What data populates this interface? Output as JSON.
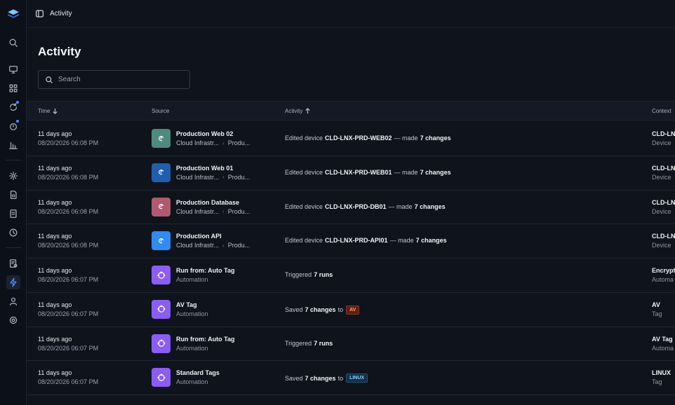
{
  "topbar": {
    "title": "Activity"
  },
  "page": {
    "title": "Activity"
  },
  "search": {
    "placeholder": "Search"
  },
  "columns": {
    "time": "Time",
    "source": "Source",
    "activity": "Activity",
    "context": "Context"
  },
  "colors": {
    "accent": "#4d8dff",
    "automation": "#8b5cf6",
    "web02": "#4f8a7f",
    "web01": "#1f5fae",
    "db": "#b05a6e",
    "api": "#2f8bf5"
  },
  "rows": [
    {
      "time": "11 days ago",
      "date": "08/20/2026 06:08 PM",
      "icon": "debian-icon",
      "color": "#4f8a7f",
      "src_name": "Production Web 02",
      "src_path1": "Cloud Infrastr...",
      "src_path2": "Produ...",
      "type": "edit",
      "verb": "Edited device",
      "target": "CLD-LNX-PRD-WEB02",
      "mid": "— made",
      "count": "7 changes",
      "ctx1": "CLD-LN",
      "ctx2": "Device"
    },
    {
      "time": "11 days ago",
      "date": "08/20/2026 06:08 PM",
      "icon": "debian-icon",
      "color": "#1f5fae",
      "src_name": "Production Web 01",
      "src_path1": "Cloud Infrastr...",
      "src_path2": "Produ...",
      "type": "edit",
      "verb": "Edited device",
      "target": "CLD-LNX-PRD-WEB01",
      "mid": "— made",
      "count": "7 changes",
      "ctx1": "CLD-LN",
      "ctx2": "Device"
    },
    {
      "time": "11 days ago",
      "date": "08/20/2026 06:08 PM",
      "icon": "debian-icon",
      "color": "#b05a6e",
      "src_name": "Production Database",
      "src_path1": "Cloud Infrastr...",
      "src_path2": "Produ...",
      "type": "edit",
      "verb": "Edited device",
      "target": "CLD-LNX-PRD-DB01",
      "mid": "— made",
      "count": "7 changes",
      "ctx1": "CLD-LN",
      "ctx2": "Device"
    },
    {
      "time": "11 days ago",
      "date": "08/20/2026 06:08 PM",
      "icon": "debian-icon",
      "color": "#2f8bf5",
      "src_name": "Production API",
      "src_path1": "Cloud Infrastr...",
      "src_path2": "Produ...",
      "type": "edit",
      "verb": "Edited device",
      "target": "CLD-LNX-PRD-API01",
      "mid": "— made",
      "count": "7 changes",
      "ctx1": "CLD-LN",
      "ctx2": "Device"
    },
    {
      "time": "11 days ago",
      "date": "08/20/2026 06:07 PM",
      "icon": "automation-icon",
      "color": "#8b5cf6",
      "src_name": "Run from: Auto Tag",
      "src_sub": "Automation",
      "type": "trigger",
      "verb": "Triggered",
      "count": "7 runs",
      "ctx1": "Encrypt",
      "ctx2": "Automa"
    },
    {
      "time": "11 days ago",
      "date": "08/20/2026 06:07 PM",
      "icon": "automation-icon",
      "color": "#8b5cf6",
      "src_name": "AV Tag",
      "src_sub": "Automation",
      "type": "save",
      "verb": "Saved",
      "count": "7 changes",
      "to": "to",
      "badge": "AV",
      "badge_kind": "av",
      "ctx1": "AV",
      "ctx2": "Tag"
    },
    {
      "time": "11 days ago",
      "date": "08/20/2026 06:07 PM",
      "icon": "automation-icon",
      "color": "#8b5cf6",
      "src_name": "Run from: Auto Tag",
      "src_sub": "Automation",
      "type": "trigger",
      "verb": "Triggered",
      "count": "7 runs",
      "ctx1": "AV Tag",
      "ctx2": "Automa"
    },
    {
      "time": "11 days ago",
      "date": "08/20/2026 06:07 PM",
      "icon": "automation-icon",
      "color": "#8b5cf6",
      "src_name": "Standard Tags",
      "src_sub": "Automation",
      "type": "save",
      "verb": "Saved",
      "count": "7 changes",
      "to": "to",
      "badge": "LINUX",
      "badge_kind": "linux",
      "ctx1": "LINUX",
      "ctx2": "Tag"
    }
  ]
}
